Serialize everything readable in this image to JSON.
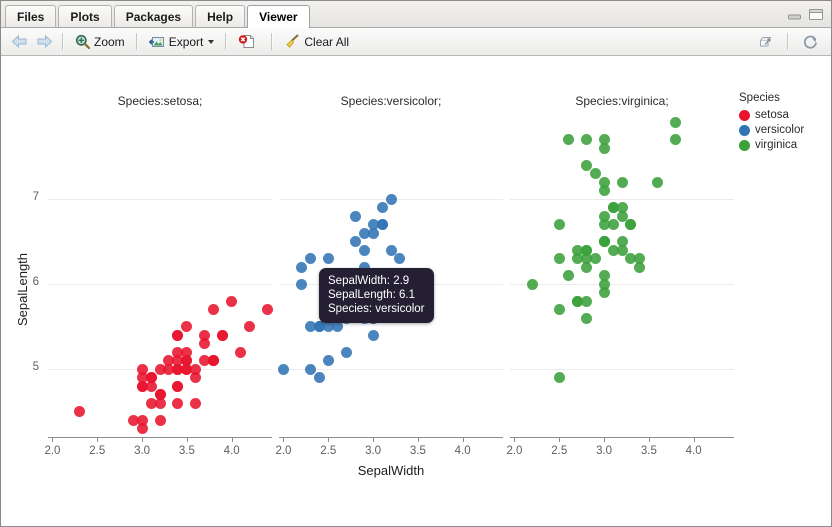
{
  "window": {
    "tabs": [
      {
        "label": "Files",
        "active": false
      },
      {
        "label": "Plots",
        "active": false
      },
      {
        "label": "Packages",
        "active": false
      },
      {
        "label": "Help",
        "active": false
      },
      {
        "label": "Viewer",
        "active": true
      }
    ],
    "controls": {
      "minimize": "minimize-icon",
      "maximize": "maximize-icon"
    }
  },
  "toolbar": {
    "back": "back-arrow-icon",
    "forward": "forward-arrow-icon",
    "zoom_label": "Zoom",
    "export_label": "Export",
    "remove_label": "",
    "clear_all_label": "Clear All",
    "publish": "publish-icon",
    "refresh": "refresh-icon"
  },
  "tooltip": {
    "lines": [
      "SepalWidth: 2.9",
      "SepalLength: 6.1",
      "Species: versicolor"
    ],
    "line1": "SepalWidth: 2.9",
    "line2": "SepalLength: 6.1",
    "line3": "Species: versicolor"
  },
  "legend": {
    "title": "Species",
    "items": [
      {
        "label": "setosa",
        "color": "#e8142d"
      },
      {
        "label": "versicolor",
        "color": "#3274b5"
      },
      {
        "label": "virginica",
        "color": "#3ba13b"
      }
    ]
  },
  "chart_data": {
    "type": "scatter",
    "title": "",
    "xlabel": "SepalWidth",
    "ylabel": "SepalLength",
    "xlim": [
      1.95,
      4.45
    ],
    "ylim": [
      4.2,
      8.0
    ],
    "xticks": [
      "2.0",
      "2.5",
      "3.0",
      "3.5",
      "4.0"
    ],
    "xtick_values": [
      2.0,
      2.5,
      3.0,
      3.5,
      4.0
    ],
    "yticks": [
      "5",
      "6",
      "7"
    ],
    "ytick_values": [
      5,
      6,
      7
    ],
    "grid": "horizontal",
    "legend_position": "right",
    "facet_variable": "Species",
    "panels": [
      {
        "title": "Species:setosa;",
        "species": "setosa",
        "color": "#e8142d",
        "points": [
          [
            3.5,
            5.1
          ],
          [
            3.0,
            4.9
          ],
          [
            3.2,
            4.7
          ],
          [
            3.1,
            4.6
          ],
          [
            3.6,
            5.0
          ],
          [
            3.9,
            5.4
          ],
          [
            3.4,
            4.6
          ],
          [
            3.4,
            5.0
          ],
          [
            2.9,
            4.4
          ],
          [
            3.1,
            4.9
          ],
          [
            3.7,
            5.4
          ],
          [
            3.4,
            4.8
          ],
          [
            3.0,
            4.8
          ],
          [
            3.0,
            4.3
          ],
          [
            4.0,
            5.8
          ],
          [
            4.4,
            5.7
          ],
          [
            3.9,
            5.4
          ],
          [
            3.5,
            5.1
          ],
          [
            3.8,
            5.7
          ],
          [
            3.8,
            5.1
          ],
          [
            3.4,
            5.4
          ],
          [
            3.7,
            5.1
          ],
          [
            3.6,
            4.6
          ],
          [
            3.3,
            5.1
          ],
          [
            3.4,
            4.8
          ],
          [
            3.0,
            5.0
          ],
          [
            3.4,
            5.0
          ],
          [
            3.5,
            5.2
          ],
          [
            3.4,
            5.2
          ],
          [
            3.2,
            4.7
          ],
          [
            3.1,
            4.8
          ],
          [
            3.4,
            5.4
          ],
          [
            4.1,
            5.2
          ],
          [
            4.2,
            5.5
          ],
          [
            3.1,
            4.9
          ],
          [
            3.2,
            5.0
          ],
          [
            3.5,
            5.5
          ],
          [
            3.6,
            4.9
          ],
          [
            3.0,
            4.4
          ],
          [
            3.4,
            5.1
          ],
          [
            3.5,
            5.0
          ],
          [
            2.3,
            4.5
          ],
          [
            3.2,
            4.4
          ],
          [
            3.5,
            5.0
          ],
          [
            3.8,
            5.1
          ],
          [
            3.0,
            4.8
          ],
          [
            3.8,
            5.1
          ],
          [
            3.2,
            4.6
          ],
          [
            3.7,
            5.3
          ],
          [
            3.3,
            5.0
          ]
        ]
      },
      {
        "title": "Species:versicolor;",
        "species": "versicolor",
        "color": "#3274b5",
        "points": [
          [
            3.2,
            7.0
          ],
          [
            3.2,
            6.4
          ],
          [
            3.1,
            6.9
          ],
          [
            2.3,
            5.5
          ],
          [
            2.8,
            6.5
          ],
          [
            2.8,
            5.7
          ],
          [
            3.3,
            6.3
          ],
          [
            2.4,
            4.9
          ],
          [
            2.9,
            6.6
          ],
          [
            2.7,
            5.2
          ],
          [
            2.0,
            5.0
          ],
          [
            3.0,
            5.9
          ],
          [
            2.2,
            6.0
          ],
          [
            2.9,
            6.1
          ],
          [
            2.9,
            5.6
          ],
          [
            3.1,
            6.7
          ],
          [
            3.0,
            5.6
          ],
          [
            2.7,
            5.8
          ],
          [
            2.2,
            6.2
          ],
          [
            2.5,
            5.6
          ],
          [
            3.2,
            5.9
          ],
          [
            2.8,
            6.1
          ],
          [
            2.5,
            6.3
          ],
          [
            2.8,
            6.1
          ],
          [
            2.9,
            6.4
          ],
          [
            3.0,
            6.6
          ],
          [
            2.8,
            6.8
          ],
          [
            3.0,
            6.7
          ],
          [
            2.9,
            6.0
          ],
          [
            2.6,
            5.7
          ],
          [
            2.4,
            5.5
          ],
          [
            2.4,
            5.5
          ],
          [
            2.7,
            5.8
          ],
          [
            2.7,
            6.0
          ],
          [
            3.0,
            5.4
          ],
          [
            3.4,
            6.0
          ],
          [
            3.1,
            6.7
          ],
          [
            2.3,
            6.3
          ],
          [
            3.0,
            5.6
          ],
          [
            2.5,
            5.5
          ],
          [
            2.6,
            5.5
          ],
          [
            3.0,
            6.1
          ],
          [
            2.6,
            5.8
          ],
          [
            2.3,
            5.0
          ],
          [
            2.7,
            5.6
          ],
          [
            3.0,
            5.7
          ],
          [
            2.9,
            5.7
          ],
          [
            2.9,
            6.2
          ],
          [
            2.5,
            5.1
          ],
          [
            2.8,
            5.7
          ]
        ]
      },
      {
        "title": "Species:virginica;",
        "species": "virginica",
        "color": "#3ba13b",
        "points": [
          [
            3.3,
            6.3
          ],
          [
            2.7,
            5.8
          ],
          [
            3.0,
            7.1
          ],
          [
            2.9,
            6.3
          ],
          [
            3.0,
            6.5
          ],
          [
            3.0,
            7.6
          ],
          [
            2.5,
            4.9
          ],
          [
            2.9,
            7.3
          ],
          [
            2.5,
            6.7
          ],
          [
            3.6,
            7.2
          ],
          [
            3.2,
            6.5
          ],
          [
            2.7,
            6.4
          ],
          [
            3.0,
            6.8
          ],
          [
            2.5,
            5.7
          ],
          [
            2.8,
            5.8
          ],
          [
            3.2,
            6.4
          ],
          [
            3.0,
            6.5
          ],
          [
            3.8,
            7.7
          ],
          [
            2.6,
            7.7
          ],
          [
            2.2,
            6.0
          ],
          [
            3.2,
            6.9
          ],
          [
            2.8,
            5.6
          ],
          [
            2.8,
            7.7
          ],
          [
            2.7,
            6.3
          ],
          [
            3.3,
            6.7
          ],
          [
            3.2,
            7.2
          ],
          [
            2.8,
            6.2
          ],
          [
            3.0,
            6.1
          ],
          [
            2.8,
            6.4
          ],
          [
            3.0,
            7.2
          ],
          [
            2.8,
            7.4
          ],
          [
            3.8,
            7.9
          ],
          [
            2.8,
            6.4
          ],
          [
            2.8,
            6.3
          ],
          [
            2.6,
            6.1
          ],
          [
            3.0,
            7.7
          ],
          [
            3.4,
            6.3
          ],
          [
            3.1,
            6.4
          ],
          [
            3.0,
            6.0
          ],
          [
            3.1,
            6.9
          ],
          [
            3.1,
            6.7
          ],
          [
            3.1,
            6.9
          ],
          [
            2.7,
            5.8
          ],
          [
            3.2,
            6.8
          ],
          [
            3.3,
            6.7
          ],
          [
            3.0,
            6.7
          ],
          [
            2.5,
            6.3
          ],
          [
            3.0,
            6.5
          ],
          [
            3.4,
            6.2
          ],
          [
            3.0,
            5.9
          ]
        ]
      }
    ]
  }
}
